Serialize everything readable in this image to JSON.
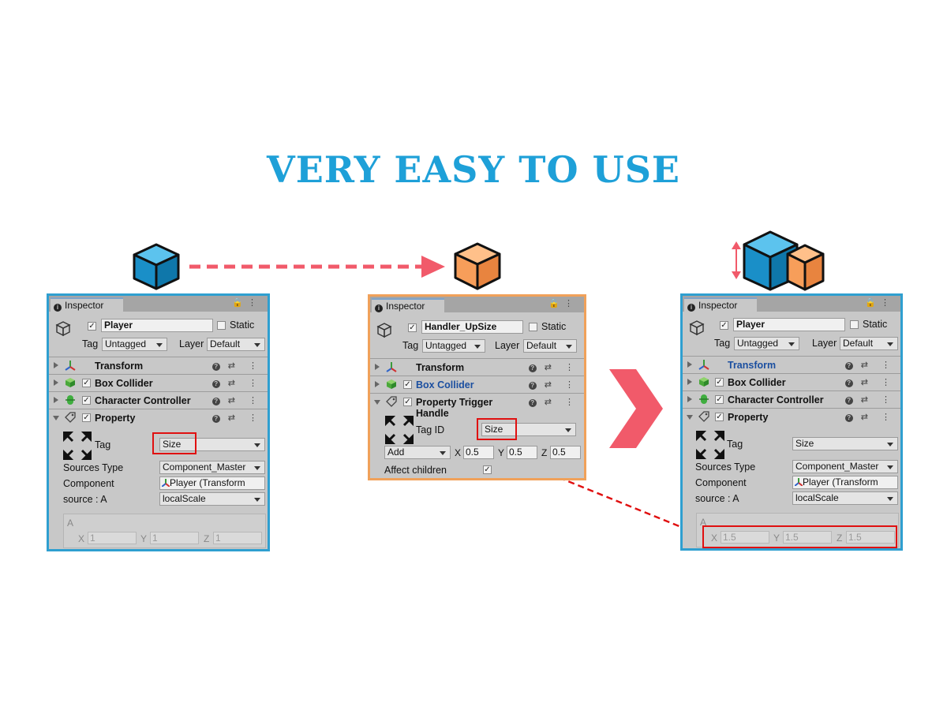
{
  "headline": "VERY EASY TO USE",
  "colors": {
    "blue": "#1ea0d8",
    "orange": "#f79e5a",
    "red": "#f15a6a",
    "highlight": "#e01010"
  },
  "left": {
    "tab": "Inspector",
    "object_name": "Player",
    "static_label": "Static",
    "tag_label": "Tag",
    "tag_value": "Untagged",
    "layer_label": "Layer",
    "layer_value": "Default",
    "components": [
      "Transform",
      "Box Collider",
      "Character Controller",
      "Property"
    ],
    "prop_tag_label": "Tag",
    "prop_tag_value": "Size",
    "sources_type_label": "Sources Type",
    "sources_type_value": "Component_Master",
    "component_label": "Component",
    "component_value": "Player (Transform",
    "source_label": "source : A",
    "source_value": "localScale",
    "a_label": "A",
    "x_label": "X",
    "x_value": "1",
    "y_label": "Y",
    "y_value": "1",
    "z_label": "Z",
    "z_value": "1"
  },
  "middle": {
    "tab": "Inspector",
    "object_name": "Handler_UpSize",
    "static_label": "Static",
    "tag_label": "Tag",
    "tag_value": "Untagged",
    "layer_label": "Layer",
    "layer_value": "Default",
    "components": [
      "Transform",
      "Box Collider",
      "Property Trigger Handle"
    ],
    "tag_id_label": "Tag ID",
    "tag_id_value": "Size",
    "op_value": "Add",
    "x_label": "X",
    "x_value": "0.5",
    "y_label": "Y",
    "y_value": "0.5",
    "z_label": "Z",
    "z_value": "0.5",
    "affect_children_label": "Affect children"
  },
  "right": {
    "tab": "Inspector",
    "object_name": "Player",
    "static_label": "Static",
    "tag_label": "Tag",
    "tag_value": "Untagged",
    "layer_label": "Layer",
    "layer_value": "Default",
    "components": [
      "Transform",
      "Box Collider",
      "Character Controller",
      "Property"
    ],
    "prop_tag_label": "Tag",
    "prop_tag_value": "Size",
    "sources_type_label": "Sources Type",
    "sources_type_value": "Component_Master",
    "component_label": "Component",
    "component_value": "Player (Transform",
    "source_label": "source : A",
    "source_value": "localScale",
    "a_label": "A",
    "x_label": "X",
    "x_value": "1.5",
    "y_label": "Y",
    "y_value": "1.5",
    "z_label": "Z",
    "z_value": "1.5"
  }
}
